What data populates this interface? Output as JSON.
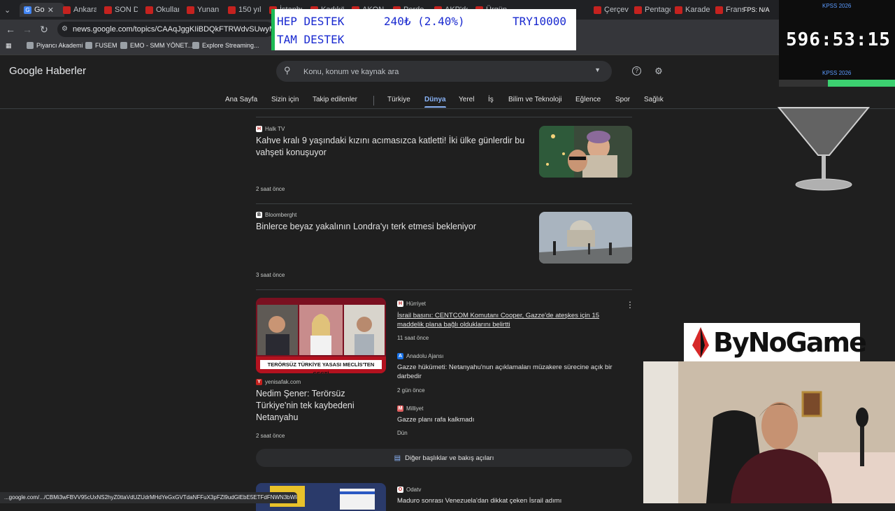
{
  "browser": {
    "tabs": [
      {
        "label": "Go",
        "active": true
      },
      {
        "label": "Ankara"
      },
      {
        "label": "SON D"
      },
      {
        "label": "Okullar"
      },
      {
        "label": "Yunan"
      },
      {
        "label": "150 yılı"
      },
      {
        "label": "İstanbul"
      },
      {
        "label": "Kadıköy"
      },
      {
        "label": "AKON"
      },
      {
        "label": "Perde"
      },
      {
        "label": "AKP'de"
      },
      {
        "label": "Ürgüp"
      },
      {
        "label": "Çerçev"
      },
      {
        "label": "Pentagon"
      },
      {
        "label": "Karade"
      },
      {
        "label": "Fransa"
      }
    ],
    "url": "news.google.com/topics/CAAqJggKIiBDQkFTRWdvSUwyMHZNRGx1YmpBU0FuUnlLQUFQAQ",
    "bookmarks": [
      "Piyancı Akademi",
      "FUSEM",
      "EMO - SMM YÖNET...",
      "Explore Streaming..."
    ],
    "fps_label": "FPS: N/A",
    "status_url": "...google.com/.../CBMi3wFBVV95cUxNS2hyZ0ttaVdUZUdrMHdYeGxGVTdaNFFuX3pFZl9udGlEbE5ETFdFNWN3bWl8U..."
  },
  "app": {
    "logo_text": "Google Haberler",
    "search_placeholder": "Konu, konum ve kaynak ara",
    "nav": [
      "Ana Sayfa",
      "Sizin için",
      "Takip edilenler",
      "Türkiye",
      "Dünya",
      "Yerel",
      "İş",
      "Bilim ve Teknoloji",
      "Eğlence",
      "Spor",
      "Sağlık"
    ],
    "active_nav": "Dünya"
  },
  "ticker": {
    "line1": "HEP DESTEK",
    "line2": "TAM DESTEK",
    "amount": "240₺ (2.40%)",
    "goal": "TRY10000"
  },
  "timer": {
    "title": "KPSS 2026",
    "countdown": "596:53:15",
    "label": "KPSS 2026"
  },
  "articles": [
    {
      "source": "Halk TV",
      "source_icon": "H",
      "headline": "Kahve kralı 9 yaşındaki kızını acımasızca katletti! İki ülke günlerdir bu vahşeti konuşuyor",
      "time": "2 saat önce"
    },
    {
      "source": "Bloomberght",
      "source_icon": "B",
      "headline": "Binlerce beyaz yakalının Londra'yı terk etmesi bekleniyor",
      "time": "3 saat önce"
    }
  ],
  "cluster": {
    "main": {
      "source": "yenisafak.com",
      "source_icon": "Y",
      "headline": "Nedim Şener: Terörsüz Türkiye'nin tek kaybedeni Netanyahu",
      "time": "2 saat önce",
      "image_caption": "TERÖRSÜZ TÜRKİYE YASASI MECLİS'TEN GEÇTİ"
    },
    "related": [
      {
        "source": "Hürriyet",
        "source_icon": "H",
        "headline": "İsrail basını: CENTCOM Komutanı Cooper, Gazze'de ateşkes için 15 maddelik plana bağlı olduklarını belirtti",
        "time": "11 saat önce"
      },
      {
        "source": "Anadolu Ajansı",
        "source_icon": "A",
        "headline": "Gazze hükümeti: Netanyahu'nun açıklamaları müzakere sürecine açık bir darbedir",
        "time": "2 gün önce"
      },
      {
        "source": "Milliyet",
        "source_icon": "M",
        "headline": "Gazze planı rafa kalkmadı",
        "time": "Dün"
      }
    ],
    "more_label": "Diğer başlıklar ve bakış açıları"
  },
  "next_article": {
    "source": "Odatv",
    "source_icon": "O",
    "headline": "Maduro sonrası Venezuela'dan dikkat çeken İsrail adımı"
  },
  "overlay": {
    "brand": "ByNoGame"
  }
}
